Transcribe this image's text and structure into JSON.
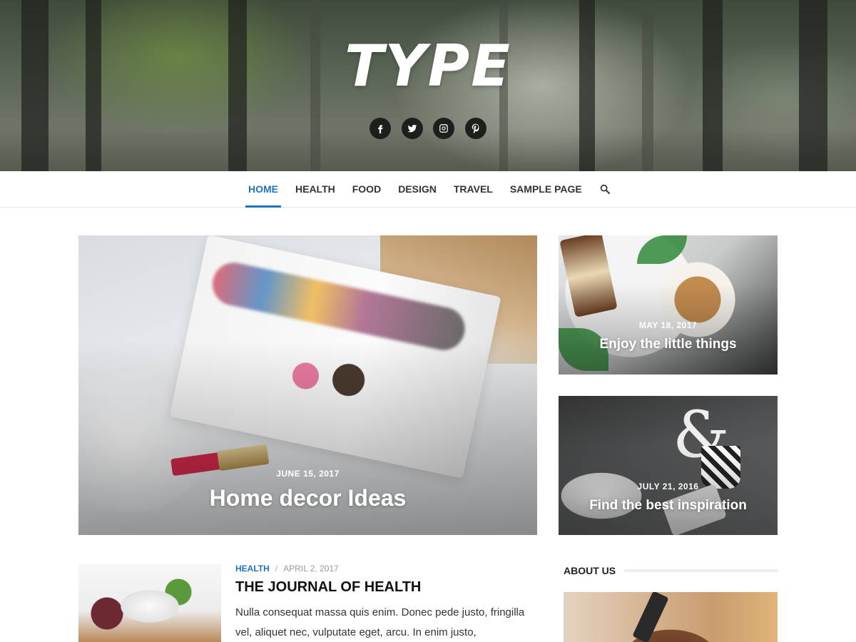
{
  "header": {
    "logo": "TYPE",
    "social": [
      {
        "name": "facebook",
        "icon": "facebook-icon"
      },
      {
        "name": "twitter",
        "icon": "twitter-icon"
      },
      {
        "name": "instagram",
        "icon": "instagram-icon"
      },
      {
        "name": "pinterest",
        "icon": "pinterest-icon"
      }
    ]
  },
  "nav": {
    "items": [
      {
        "label": "HOME",
        "active": true
      },
      {
        "label": "HEALTH",
        "active": false
      },
      {
        "label": "FOOD",
        "active": false
      },
      {
        "label": "DESIGN",
        "active": false
      },
      {
        "label": "TRAVEL",
        "active": false
      },
      {
        "label": "SAMPLE PAGE",
        "active": false
      }
    ],
    "search_icon": "search-icon",
    "accent_color": "#1e73be"
  },
  "featured": {
    "main": {
      "date": "JUNE 15, 2017",
      "title": "Home decor Ideas"
    },
    "side": [
      {
        "date": "MAY 18, 2017",
        "title": "Enjoy the little things"
      },
      {
        "date": "JULY 21, 2016",
        "title": "Find the best inspiration"
      }
    ]
  },
  "post": {
    "category": "HEALTH",
    "separator": "/",
    "date": "APRIL 2, 2017",
    "title": "THE JOURNAL OF HEALTH",
    "excerpt": "Nulla consequat massa quis enim. Donec pede justo, fringilla vel, aliquet nec, vulputate eget, arcu. In enim justo,"
  },
  "sidebar": {
    "about_title": "ABOUT US"
  }
}
